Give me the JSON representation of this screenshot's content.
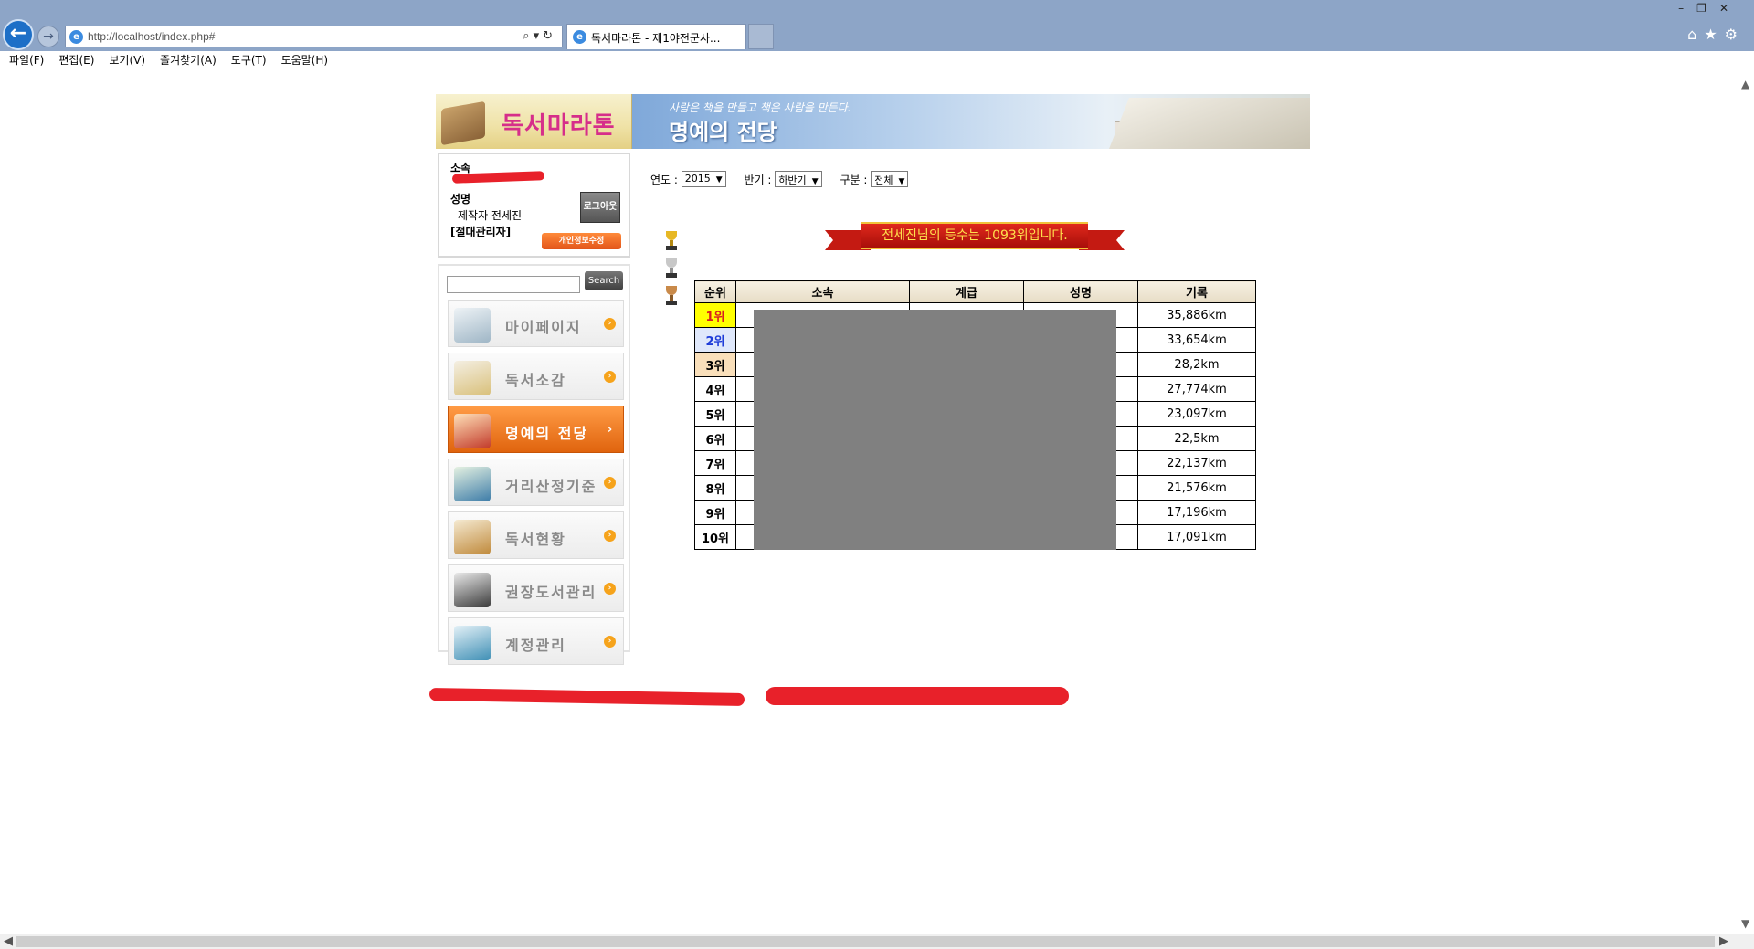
{
  "browser": {
    "url": "http://localhost/index.php#",
    "tab_title": "독서마라톤 - 제1야전군사...",
    "menu": [
      "파일(F)",
      "편집(E)",
      "보기(V)",
      "즐겨찾기(A)",
      "도구(T)",
      "도움말(H)"
    ]
  },
  "header": {
    "logo_text": "독서마라톤",
    "subtitle": "사람은 책을 만들고 책은 사람을 만든다.",
    "title": "명예의 전당"
  },
  "login": {
    "affiliation_label": "소속",
    "name_label": "성명",
    "name_value": "제작자 전세진",
    "role": "[절대관리자]",
    "logout_label": "로그아웃",
    "profile_label": "개인정보수정"
  },
  "search": {
    "button_label": "Search",
    "value": ""
  },
  "nav": {
    "items": [
      {
        "label": "마이페이지"
      },
      {
        "label": "독서소감"
      },
      {
        "label": "명예의 전당"
      },
      {
        "label": "거리산정기준"
      },
      {
        "label": "독서현황"
      },
      {
        "label": "권장도서관리"
      },
      {
        "label": "계정관리"
      }
    ]
  },
  "filters": {
    "year_label": "연도 :",
    "year_value": "2015",
    "half_label": "반기 :",
    "half_value": "하반기",
    "type_label": "구분 :",
    "type_value": "전체"
  },
  "rank_message": "전세진님의 등수는 1093위입니다.",
  "table": {
    "headers": [
      "순위",
      "소속",
      "계급",
      "성명",
      "기록"
    ],
    "rows": [
      {
        "rank": "1위",
        "record": "35,886km"
      },
      {
        "rank": "2위",
        "record": "33,654km"
      },
      {
        "rank": "3위",
        "record": "28,2km"
      },
      {
        "rank": "4위",
        "record": "27,774km"
      },
      {
        "rank": "5위",
        "record": "23,097km"
      },
      {
        "rank": "6위",
        "record": "22,5km"
      },
      {
        "rank": "7위",
        "record": "22,137km"
      },
      {
        "rank": "8위",
        "record": "21,576km"
      },
      {
        "rank": "9위",
        "record": "17,196km"
      },
      {
        "rank": "10위",
        "record": "17,091km"
      }
    ]
  },
  "colors": {
    "rank1_bg": "#ffff00",
    "rank2_bg": "#dfe8fb",
    "rank3_bg": "#f9dfba",
    "accent_orange": "#e0640e",
    "ribbon_red": "#c41a12"
  }
}
